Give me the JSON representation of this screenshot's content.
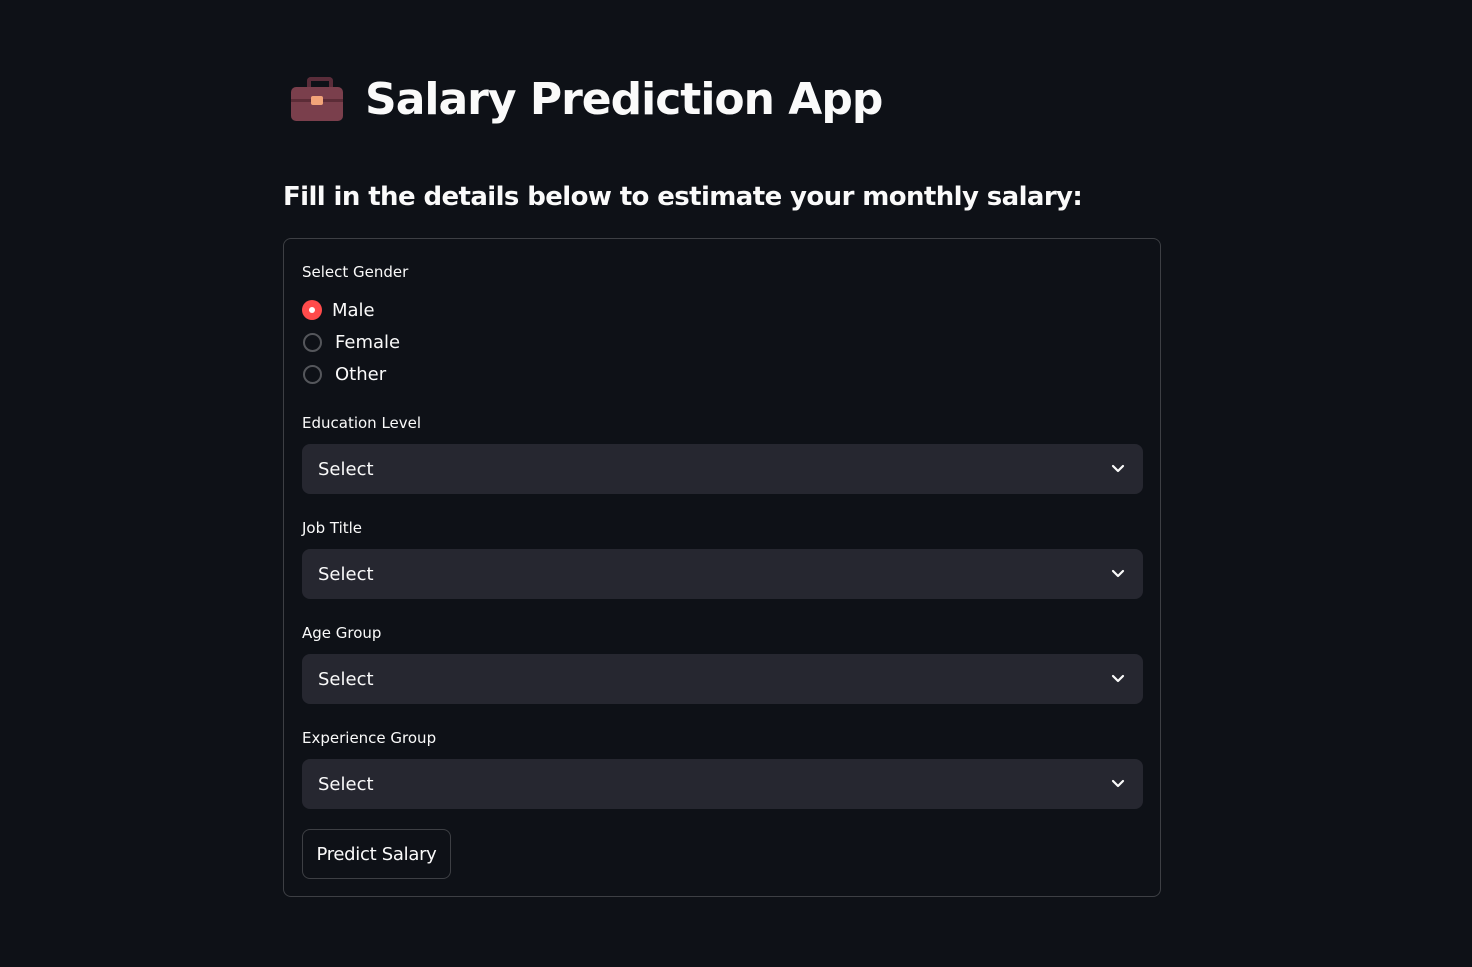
{
  "header": {
    "title": "Salary Prediction App",
    "title_icon": "briefcase-icon"
  },
  "subtitle": "Fill in the details below to estimate your monthly salary:",
  "form": {
    "gender": {
      "label": "Select Gender",
      "options": [
        "Male",
        "Female",
        "Other"
      ],
      "selected": "Male"
    },
    "education": {
      "label": "Education Level",
      "value": "Select"
    },
    "job_title": {
      "label": "Job Title",
      "value": "Select"
    },
    "age_group": {
      "label": "Age Group",
      "value": "Select"
    },
    "experience_group": {
      "label": "Experience Group",
      "value": "Select"
    },
    "submit_label": "Predict Salary"
  },
  "colors": {
    "background": "#0e1117",
    "accent": "#ff4b4b",
    "select_bg": "#262730",
    "text": "#fafafa"
  }
}
